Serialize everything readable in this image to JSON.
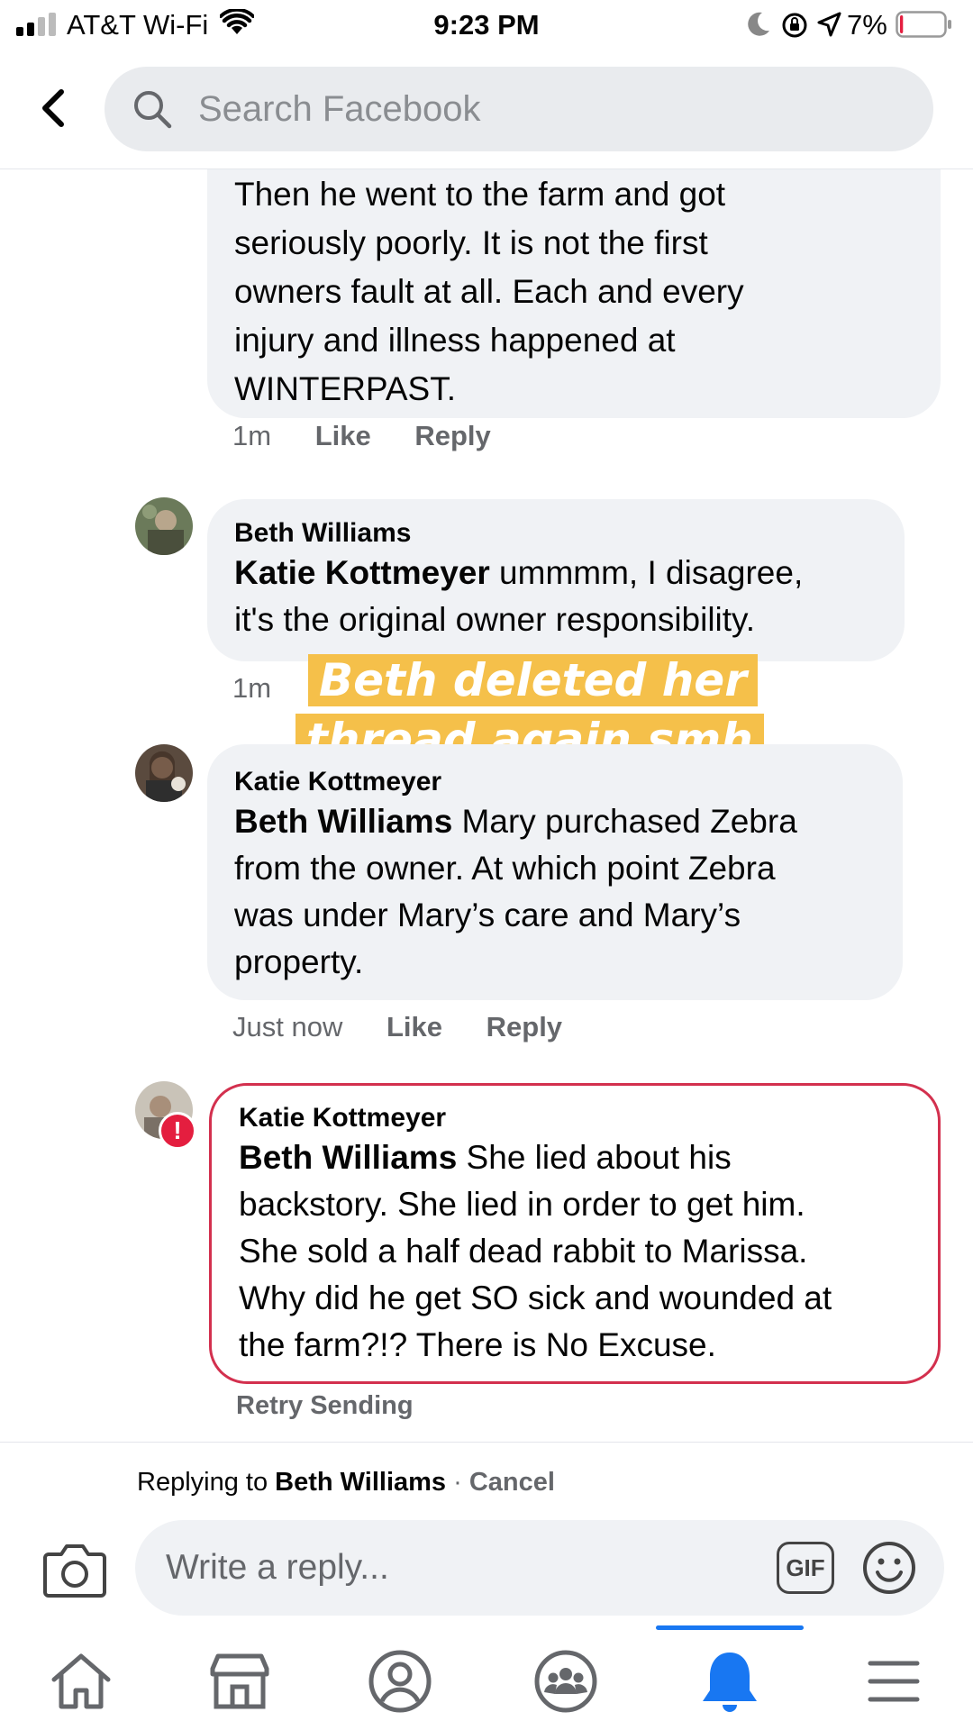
{
  "status_bar": {
    "carrier": "AT&T Wi-Fi",
    "time": "9:23 PM",
    "battery_percent": "7%",
    "battery_level": 0.07
  },
  "header": {
    "search_placeholder": "Search Facebook"
  },
  "comments": [
    {
      "author": "",
      "lines": [
        "Then he went to the farm and got",
        "seriously poorly. It is not the first",
        "owners fault at all. Each and every",
        "injury and illness happened at",
        "WINTERPAST."
      ],
      "time": "1m",
      "like": "Like",
      "reply": "Reply"
    },
    {
      "author": "Beth Williams",
      "mention": "Katie Kottmeyer",
      "first_line_rest": " ummmm, I disagree,",
      "lines": [
        "it's the original owner responsibility."
      ],
      "time": "1m"
    },
    {
      "author": "Katie Kottmeyer",
      "mention": "Beth Williams",
      "first_line_rest": " Mary purchased Zebra",
      "lines": [
        "from the owner. At which point Zebra",
        "was under Mary’s care and Mary’s",
        "property."
      ],
      "time": "Just now",
      "like": "Like",
      "reply": "Reply"
    },
    {
      "author": "Katie Kottmeyer",
      "mention": "Beth Williams",
      "first_line_rest": " She lied about his",
      "lines": [
        "backstory. She lied in order to get him.",
        "She sold a half dead rabbit to Marissa.",
        "Why did he get SO sick and wounded at",
        "the farm?!? There is No Excuse."
      ],
      "status": "Retry Sending"
    }
  ],
  "sticker": {
    "line1": "Beth deleted her",
    "line2": "thread again smh",
    "color": "#f5c04a"
  },
  "composer": {
    "replying_to_prefix": "Replying to ",
    "replying_to_name": "Beth Williams",
    "separator": " · ",
    "cancel": "Cancel",
    "placeholder": "Write a reply...",
    "gif_label": "GIF"
  },
  "bottom_nav": {
    "items": [
      "home-icon",
      "marketplace-icon",
      "profile-icon",
      "groups-icon",
      "notifications-icon",
      "menu-icon"
    ],
    "active": "notifications-icon",
    "accent": "#1877f2"
  },
  "colors": {
    "bubble_bg": "#f0f2f5",
    "error_border": "#d3304e",
    "muted_text": "#65676b"
  }
}
